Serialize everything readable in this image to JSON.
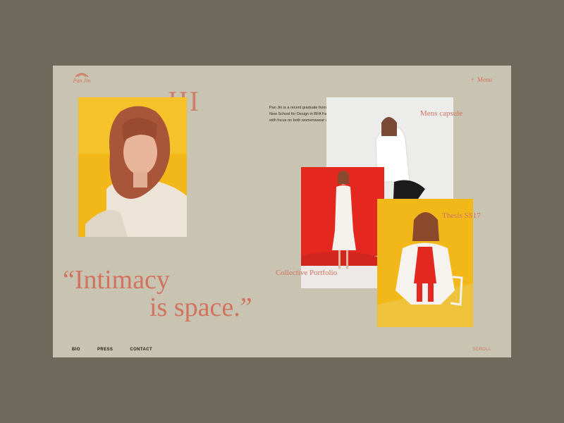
{
  "brand": {
    "name": "Pan Jin"
  },
  "header": {
    "menu_icon": "plus-icon",
    "menu_label": "Menu"
  },
  "hero": {
    "numeral": "III"
  },
  "bio": {
    "text": "Pan Jin is a recent graduate from Parsons the New School for Design in BFA Fashion Design, with focus on both womenswear and menswear."
  },
  "projects": [
    {
      "caption": "Mens capsule"
    },
    {
      "caption": "Collective Portfolio"
    },
    {
      "caption": "Thesis SS17"
    }
  ],
  "quote": {
    "line1": "“Intimacy",
    "line2": "is space.”"
  },
  "footer": {
    "nav": [
      {
        "label": "BIO"
      },
      {
        "label": "PRESS"
      },
      {
        "label": "CONTACT"
      }
    ],
    "scroll_label": "SCROLL"
  },
  "colors": {
    "accent": "#d0735f",
    "page_bg": "#c9c4b1",
    "outer_bg": "#6d6a5c",
    "yellow": "#f2b81a",
    "red": "#e5281f"
  }
}
